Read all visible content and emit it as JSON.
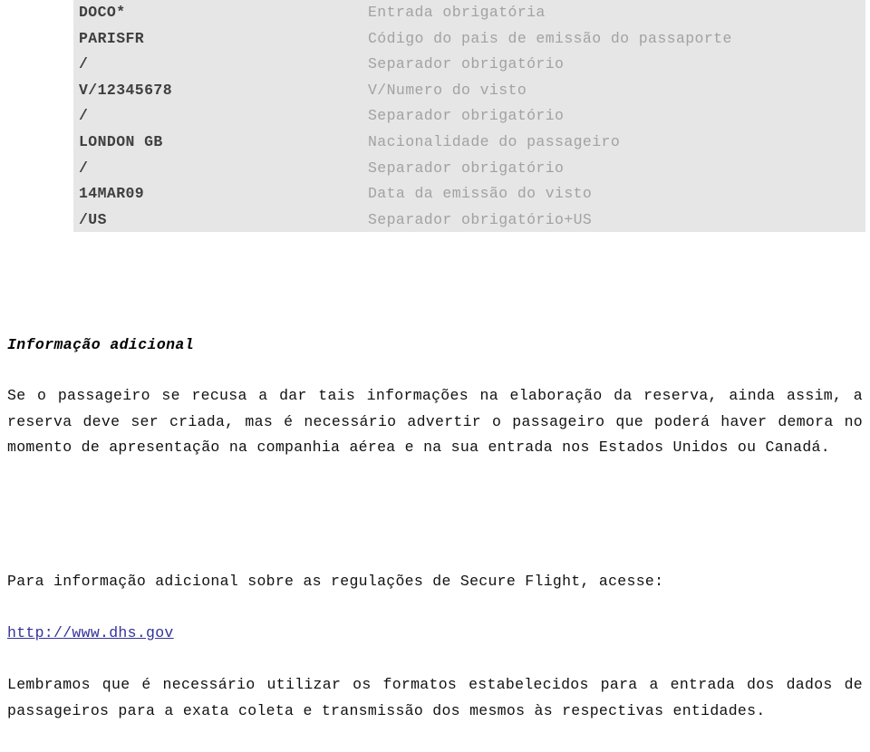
{
  "format_table": {
    "rows": [
      {
        "code": "DOCO*",
        "description": "Entrada obrigatória"
      },
      {
        "code": "PARISFR",
        "description": "Código do pais de emissão do passaporte"
      },
      {
        "code": "/",
        "description": "Separador obrigatório"
      },
      {
        "code": "V/12345678",
        "description": "V/Numero do visto"
      },
      {
        "code": "/",
        "description": "Separador obrigatório"
      },
      {
        "code": "LONDON GB",
        "description": "Nacionalidade do passageiro"
      },
      {
        "code": "/",
        "description": "Separador obrigatório"
      },
      {
        "code": "14MAR09",
        "description": "Data da emissão do visto"
      },
      {
        "code": "/US",
        "description": "Separador obrigatório+US"
      }
    ],
    "background_color": "#e6e6e6",
    "code_color": "#3f3f3f",
    "description_color": "#a2a2a2"
  },
  "additional_info": {
    "heading": "Informação adicional",
    "paragraph": "Se o passageiro se recusa a dar tais informações na elaboração da reserva, ainda assim, a reserva deve ser criada, mas é necessário advertir o passageiro que poderá haver demora no momento de apresentação na companhia aérea e na sua entrada nos Estados Unidos ou Canadá."
  },
  "secure_flight": {
    "lead_text": "Para informação adicional sobre as regulações de Secure Flight, acesse:",
    "link_text": "http://www.dhs.gov",
    "link_color": "#333399"
  },
  "reminder": {
    "paragraph": "Lembramos que é necessário utilizar os formatos estabelecidos para a entrada dos dados de passageiros para a exata coleta e transmissão dos mesmos às respectivas entidades."
  }
}
